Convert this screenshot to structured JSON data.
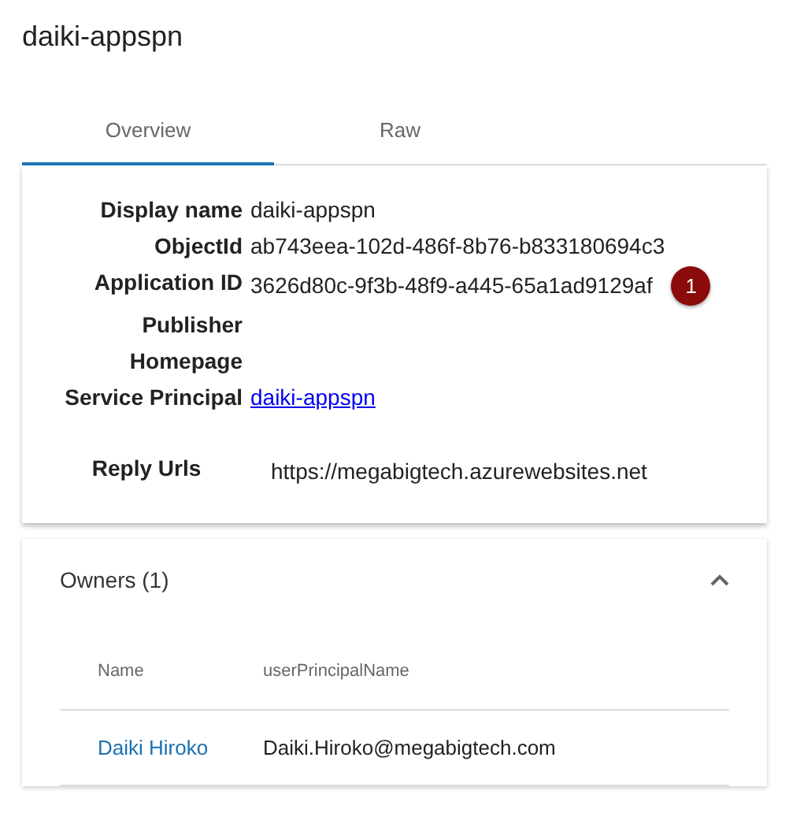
{
  "title": "daiki-appspn",
  "tabs": [
    {
      "label": "Overview",
      "selected": true
    },
    {
      "label": "Raw",
      "selected": false
    }
  ],
  "properties": [
    {
      "label": "Display name",
      "kind": "text",
      "value": "daiki-appspn"
    },
    {
      "label": "ObjectId",
      "kind": "text",
      "value": "ab743eea-102d-486f-8b76-b833180694c3"
    },
    {
      "label": "Application ID",
      "kind": "text",
      "value": "3626d80c-9f3b-48f9-a445-65a1ad9129af",
      "badge": "1"
    },
    {
      "label": "Publisher"
    },
    {
      "label": "Homepage"
    },
    {
      "label": "Service Principal",
      "kind": "link",
      "value": "daiki-appspn"
    }
  ],
  "reply_urls": {
    "label": "Reply Urls",
    "values": [
      "https://megabigtech.azurewebsites.net"
    ]
  },
  "owners": {
    "title": "Owners (1)",
    "expanded": true,
    "columns": [
      "Name",
      "userPrincipalName"
    ],
    "rows": [
      {
        "name": "Daiki Hiroko",
        "user_principal_name": "Daiki.Hiroko@megabigtech.com"
      }
    ]
  }
}
